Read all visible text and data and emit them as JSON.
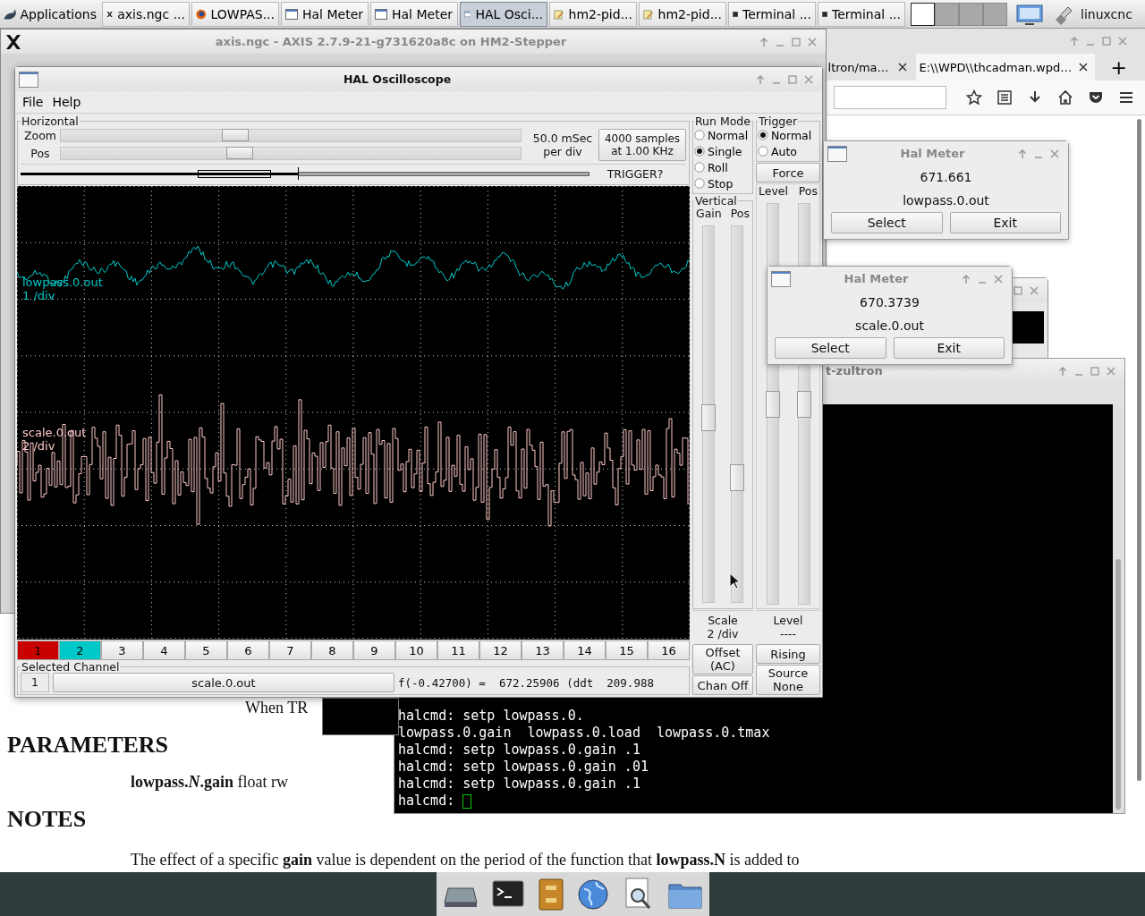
{
  "taskbar": {
    "menu": "Applications",
    "tasks": [
      {
        "label": "axis.ngc ...",
        "kind": "x",
        "selected": false
      },
      {
        "label": "LOWPAS...",
        "kind": "browser",
        "selected": false
      },
      {
        "label": "Hal Meter",
        "kind": "window",
        "selected": false
      },
      {
        "label": "Hal Meter",
        "kind": "window",
        "selected": false
      },
      {
        "label": "HAL Osci...",
        "kind": "window",
        "selected": true
      },
      {
        "label": "hm2-pid...",
        "kind": "editor",
        "selected": false
      },
      {
        "label": "hm2-pid...",
        "kind": "editor",
        "selected": false
      },
      {
        "label": "Terminal ...",
        "kind": "terminal",
        "selected": false
      },
      {
        "label": "Terminal ...",
        "kind": "terminal",
        "selected": false
      }
    ],
    "workspaces": [
      {
        "selected": true
      },
      {
        "selected": false
      },
      {
        "selected": false
      },
      {
        "selected": false
      }
    ],
    "user": "linuxcnc"
  },
  "browser": {
    "tabs": [
      {
        "label": "ltron/ma…",
        "selected": false
      },
      {
        "label": "E:\\\\WPD\\\\thcadman.wpd…",
        "selected": true
      }
    ],
    "new_tab": "+",
    "page": {
      "fragment": "When TR",
      "heading_1": "PARAMETERS",
      "parameter": "**lowpass.*N*.gain** float rw",
      "heading_2": "NOTES",
      "paragraph": "The effect of a specific **gain** value is dependent on the period of the function that **lowpass.N** is added to"
    }
  },
  "axis": {
    "title": "axis.ngc - AXIS 2.7.9-21-g731620a8c on HM2-Stepper"
  },
  "terminal": {
    "title": "t-zultron",
    "lines": [
      "halcmd: setp lowpass.0.",
      "lowpass.0.gain  lowpass.0.load  lowpass.0.tmax",
      "halcmd: setp lowpass.0.gain .1",
      "halcmd: setp lowpass.0.gain .01",
      "halcmd: setp lowpass.0.gain .1"
    ],
    "prompt": "halcmd: "
  },
  "meters": [
    {
      "title": "Hal Meter",
      "value": "671.661",
      "pin": "lowpass.0.out",
      "buttons": [
        "Select",
        "Exit"
      ]
    },
    {
      "title": "Hal Meter",
      "value": "670.3739",
      "pin": "scale.0.out",
      "buttons": [
        "Select",
        "Exit"
      ]
    }
  ],
  "oscilloscope": {
    "title": "HAL Oscilloscope",
    "menu": [
      "File",
      "Help"
    ],
    "horizontal": {
      "label": "Horizontal",
      "zoom": {
        "label": "Zoom",
        "level": 0.38
      },
      "pos": {
        "label": "Pos",
        "level": 0.39
      },
      "rate": "50.0 mSec\nper div",
      "samples": "4000 samples\nat 1.00 KHz",
      "trigger_status": "TRIGGER?"
    },
    "traces": [
      {
        "name": "lowpass.0.out",
        "scale": "1 /div",
        "color": "#00c8c8"
      },
      {
        "name": "scale.0.out",
        "scale": "2 /div",
        "color": "#ffc8c8"
      }
    ],
    "channels": [
      {
        "label": "1",
        "color": "#c80000"
      },
      {
        "label": "2",
        "color": "#00c8c8"
      },
      {
        "label": "3"
      },
      {
        "label": "4"
      },
      {
        "label": "5"
      },
      {
        "label": "6"
      },
      {
        "label": "7"
      },
      {
        "label": "8"
      },
      {
        "label": "9"
      },
      {
        "label": "10"
      },
      {
        "label": "11"
      },
      {
        "label": "12"
      },
      {
        "label": "13"
      },
      {
        "label": "14"
      },
      {
        "label": "15"
      },
      {
        "label": "16"
      }
    ],
    "selected_channel": {
      "label": "Selected Channel",
      "number": "1",
      "pin": "scale.0.out",
      "readout": "f(-0.42700) =  672.25906 (ddt  209.988"
    },
    "run_mode": {
      "label": "Run Mode",
      "options": [
        {
          "label": "Normal",
          "selected": false
        },
        {
          "label": "Single",
          "selected": true
        },
        {
          "label": "Roll",
          "selected": false
        },
        {
          "label": "Stop",
          "selected": false
        }
      ]
    },
    "vertical": {
      "label": "Vertical",
      "gain_label": "Gain",
      "pos_label": "Pos",
      "gain": {
        "level": 0.49
      },
      "pos": {
        "level": 0.33
      },
      "scale": "Scale\n2 /div",
      "offset": "Offset\n(AC)",
      "chan_off": "Chan Off"
    },
    "trigger": {
      "label": "Trigger",
      "options": [
        {
          "label": "Normal",
          "selected": true
        },
        {
          "label": "Auto",
          "selected": false
        }
      ],
      "force": "Force",
      "level_label": "Level",
      "pos_label": "Pos",
      "level": {
        "level": 0.5
      },
      "pos": {
        "level": 0.5
      },
      "level_readout": "Level\n----",
      "edge": "Rising",
      "source": "Source\nNone"
    }
  }
}
